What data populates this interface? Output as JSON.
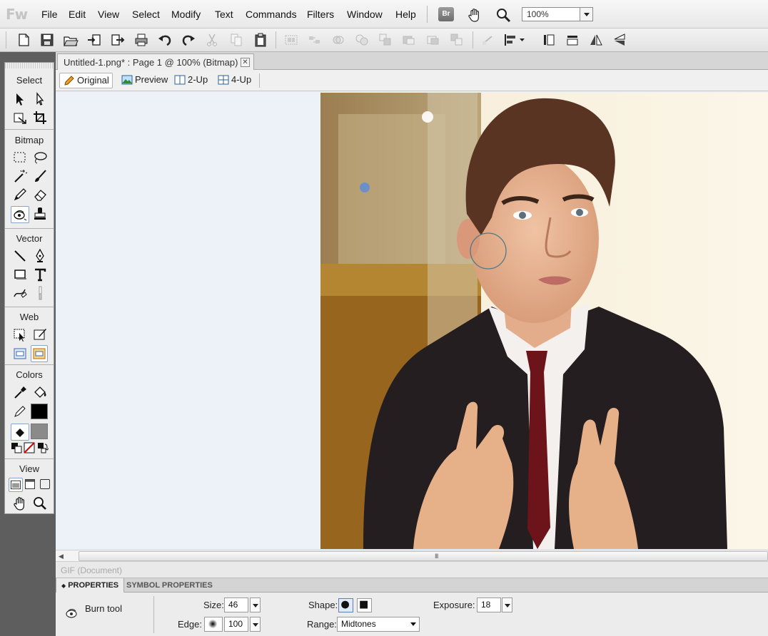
{
  "app": {
    "logo": "Fw"
  },
  "menu": [
    "File",
    "Edit",
    "View",
    "Select",
    "Modify",
    "Text",
    "Commands",
    "Filters",
    "Window",
    "Help"
  ],
  "topbar": {
    "bridge_label": "Br",
    "zoom_value": "100%"
  },
  "document": {
    "tab_title": "Untitled-1.png* : Page 1 @ 100% (Bitmap)",
    "close_glyph": "✕"
  },
  "view_tabs": [
    "Original",
    "Preview",
    "2-Up",
    "4-Up"
  ],
  "tools_panel": {
    "sections": [
      "Select",
      "Bitmap",
      "Vector",
      "Web",
      "Colors",
      "View"
    ],
    "active_tool": "burn-tool"
  },
  "status": {
    "text": "GIF (Document)"
  },
  "scrollbar": {
    "left_arrow": "◀",
    "grip": "III"
  },
  "properties": {
    "tabs": [
      "PROPERTIES",
      "SYMBOL PROPERTIES"
    ],
    "tool_name": "Burn tool",
    "size_label": "Size:",
    "size_value": "46",
    "edge_label": "Edge:",
    "edge_value": "100",
    "shape_label": "Shape:",
    "range_label": "Range:",
    "range_value": "Midtones",
    "exposure_label": "Exposure:",
    "exposure_value": "18"
  },
  "colors": {
    "canvas_bg": "#edf2f9",
    "accent": "#5d7fb5",
    "stroke_color": "#000000",
    "fill_color": "#8a8a8a"
  }
}
